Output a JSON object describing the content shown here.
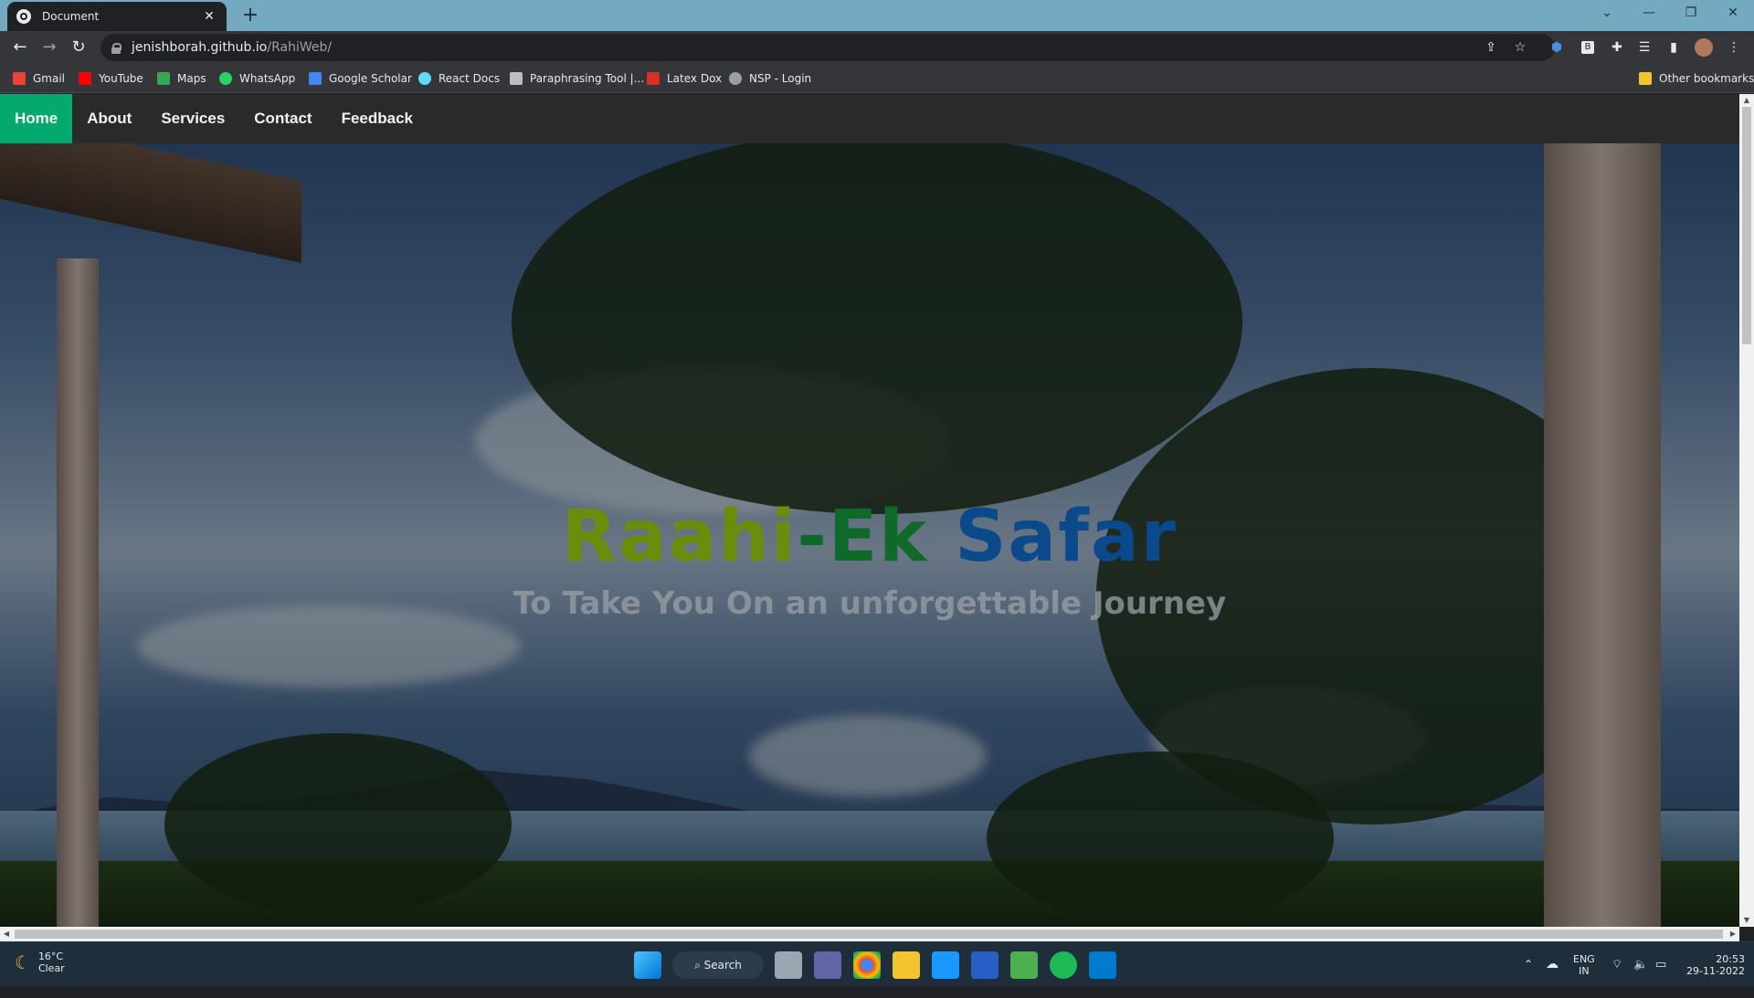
{
  "browser": {
    "tab_title": "Document",
    "new_tab": "+",
    "url_host": "jenishborah.github.io",
    "url_path": "/RahiWeb/",
    "bookmarks": [
      {
        "label": "Gmail",
        "icon": "gmail-icon",
        "color": "#ea4335"
      },
      {
        "label": "YouTube",
        "icon": "youtube-icon",
        "color": "#ff0000"
      },
      {
        "label": "Maps",
        "icon": "maps-icon",
        "color": "#34a853"
      },
      {
        "label": "WhatsApp",
        "icon": "whatsapp-icon",
        "color": "#25d366"
      },
      {
        "label": "Google Scholar",
        "icon": "scholar-icon",
        "color": "#4285f4"
      },
      {
        "label": "React Docs",
        "icon": "react-icon",
        "color": "#61dafb"
      },
      {
        "label": "Paraphrasing Tool |...",
        "icon": "quill-icon",
        "color": "#bdbdbd"
      },
      {
        "label": "Latex Dox",
        "icon": "latex-icon",
        "color": "#d93025"
      },
      {
        "label": "NSP - Login",
        "icon": "globe-icon",
        "color": "#9aa0a6"
      }
    ],
    "other_bookmarks": "Other bookmarks"
  },
  "site": {
    "nav": [
      {
        "label": "Home",
        "active": true
      },
      {
        "label": "About",
        "active": false
      },
      {
        "label": "Services",
        "active": false
      },
      {
        "label": "Contact",
        "active": false
      },
      {
        "label": "Feedback",
        "active": false
      }
    ],
    "hero_title_part1": "Raahi",
    "hero_title_part2": "-Ek ",
    "hero_title_part3": "Safar",
    "hero_subtitle": "To Take You On an unforgettable Journey",
    "accent_color": "#04aa6d"
  },
  "taskbar": {
    "weather_temp": "16°C",
    "weather_desc": "Clear",
    "search_label": "Search",
    "lang_top": "ENG",
    "lang_bottom": "IN",
    "time": "20:53",
    "date": "29-11-2022"
  }
}
